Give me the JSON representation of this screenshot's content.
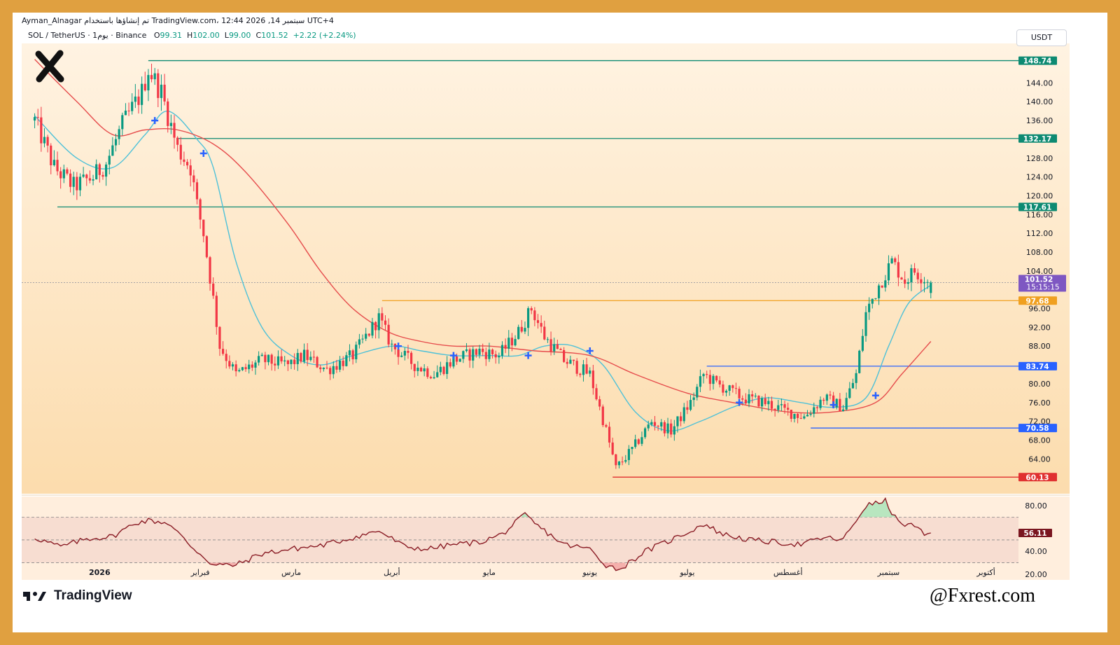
{
  "header": {
    "author": "Ayman_Alnagar",
    "published_note": "تم إنشاؤها باستخدام TradingView.com، 12:44 2026 ,14 سبتمبر UTC+4",
    "symbol": "SOL / TetherUS · 1يوم · Binance",
    "open_label": "O",
    "open": "99.31",
    "high_label": "H",
    "high": "102.00",
    "low_label": "L",
    "low": "99.00",
    "close_label": "C",
    "close": "101.52",
    "change": "+2.22 (+2.24%)",
    "currency": "USDT"
  },
  "footer": {
    "tradingview_logo": "TradingView",
    "handle": "@Fxrest.com"
  },
  "icons": {
    "brand": "x-brand-icon",
    "tradingview": "tradingview-logo-icon"
  },
  "colors": {
    "frame": "#e0a040",
    "background_top": "#fff3e2",
    "background_bottom": "#fcdcad",
    "bull": "#089981",
    "bear": "#f23645",
    "fast_ma": "#4ec1d8",
    "slow_ma": "#e64d4d",
    "resistance": "#0d8a72",
    "support": "#2962ff",
    "orange_level": "#f0a020",
    "low_level": "#e03030",
    "last_price": "#7e57c2",
    "rsi": "#8a1c25"
  },
  "chart_data": [
    {
      "type": "candlestick",
      "title": "SOL / TetherUS",
      "xlabel": "",
      "ylabel": "",
      "ylim": [
        56.6,
        152.4
      ],
      "y_ticks": [
        "144.00",
        "140.00",
        "136.00",
        "128.00",
        "124.00",
        "120.00",
        "116.00",
        "112.00",
        "108.00",
        "104.00",
        "96.00",
        "92.00",
        "88.00",
        "80.00",
        "76.00",
        "72.00",
        "68.00",
        "64.00"
      ],
      "x_ticks": [
        {
          "label": "2026",
          "date": "2026-01-01"
        },
        {
          "label": "فبراير",
          "date": "2026-02-01"
        },
        {
          "label": "مارس",
          "date": "2026-03-01"
        },
        {
          "label": "أبريل",
          "date": "2026-04-01"
        },
        {
          "label": "مايو",
          "date": "2026-05-01"
        },
        {
          "label": "يونيو",
          "date": "2026-06-01"
        },
        {
          "label": "يوليو",
          "date": "2026-07-01"
        },
        {
          "label": "أغسطس",
          "date": "2026-08-01"
        },
        {
          "label": "سبتمبر",
          "date": "2026-09-01"
        },
        {
          "label": "أكتوبر",
          "date": "2026-10-01"
        }
      ],
      "price_path": [
        [
          "2025-12-12",
          136
        ],
        [
          "2025-12-18",
          126
        ],
        [
          "2025-12-24",
          122
        ],
        [
          "2025-12-30",
          124
        ],
        [
          "2026-01-03",
          127
        ],
        [
          "2026-01-08",
          135
        ],
        [
          "2026-01-14",
          142
        ],
        [
          "2026-01-16",
          147
        ],
        [
          "2026-01-20",
          142
        ],
        [
          "2026-01-25",
          130
        ],
        [
          "2026-01-29",
          126
        ],
        [
          "2026-01-31",
          118
        ],
        [
          "2026-02-02",
          112
        ],
        [
          "2026-02-05",
          98
        ],
        [
          "2026-02-07",
          88
        ],
        [
          "2026-02-12",
          82
        ],
        [
          "2026-02-20",
          85
        ],
        [
          "2026-02-28",
          84
        ],
        [
          "2026-03-05",
          86
        ],
        [
          "2026-03-12",
          83
        ],
        [
          "2026-03-20",
          86
        ],
        [
          "2026-03-28",
          94
        ],
        [
          "2026-04-01",
          88
        ],
        [
          "2026-04-08",
          84
        ],
        [
          "2026-04-14",
          82
        ],
        [
          "2026-04-20",
          85
        ],
        [
          "2026-04-28",
          87
        ],
        [
          "2026-05-04",
          86
        ],
        [
          "2026-05-10",
          91
        ],
        [
          "2026-05-14",
          96
        ],
        [
          "2026-05-18",
          90
        ],
        [
          "2026-05-24",
          85
        ],
        [
          "2026-06-01",
          82
        ],
        [
          "2026-06-06",
          70
        ],
        [
          "2026-06-09",
          62
        ],
        [
          "2026-06-14",
          66
        ],
        [
          "2026-06-20",
          72
        ],
        [
          "2026-06-26",
          70
        ],
        [
          "2026-07-02",
          76
        ],
        [
          "2026-07-06",
          82
        ],
        [
          "2026-07-10",
          80
        ],
        [
          "2026-07-18",
          77
        ],
        [
          "2026-07-25",
          76
        ],
        [
          "2026-08-01",
          74
        ],
        [
          "2026-08-06",
          73
        ],
        [
          "2026-08-12",
          77
        ],
        [
          "2026-08-18",
          75
        ],
        [
          "2026-08-22",
          82
        ],
        [
          "2026-08-25",
          95
        ],
        [
          "2026-08-29",
          101
        ],
        [
          "2026-09-02",
          106
        ],
        [
          "2026-09-06",
          102
        ],
        [
          "2026-09-09",
          104
        ],
        [
          "2026-09-14",
          101.52
        ]
      ],
      "horizontal_levels": [
        {
          "value": 148.74,
          "label": "148.74",
          "kind": "resistance",
          "from": "2026-01-16"
        },
        {
          "value": 132.17,
          "label": "132.17",
          "kind": "resistance",
          "from": "2026-01-25"
        },
        {
          "value": 117.61,
          "label": "117.61",
          "kind": "resistance",
          "from": "2025-12-19"
        },
        {
          "value": 97.68,
          "label": "97.68",
          "kind": "orange",
          "from": "2026-03-29"
        },
        {
          "value": 83.74,
          "label": "83.74",
          "kind": "support",
          "from": "2026-07-07"
        },
        {
          "value": 70.58,
          "label": "70.58",
          "kind": "support",
          "from": "2026-08-08"
        },
        {
          "value": 60.13,
          "label": "60.13",
          "kind": "low",
          "from": "2026-06-08"
        }
      ],
      "last_price": {
        "value": 101.52,
        "label": "101.52",
        "countdown": "15:15:15"
      },
      "cross_markers": [
        [
          "2026-01-18",
          136
        ],
        [
          "2026-02-02",
          129
        ],
        [
          "2026-04-03",
          88
        ],
        [
          "2026-04-20",
          86
        ],
        [
          "2026-05-13",
          86
        ],
        [
          "2026-06-01",
          87
        ],
        [
          "2026-07-17",
          76
        ],
        [
          "2026-08-15",
          75.5
        ],
        [
          "2026-08-28",
          77.5
        ]
      ],
      "moving_averages": [
        {
          "color_key": "fast_ma",
          "points": [
            [
              "2025-12-12",
              137
            ],
            [
              "2025-12-25",
              128
            ],
            [
              "2026-01-05",
              126
            ],
            [
              "2026-01-15",
              133
            ],
            [
              "2026-01-22",
              138
            ],
            [
              "2026-01-31",
              132
            ],
            [
              "2026-02-05",
              126
            ],
            [
              "2026-02-12",
              106
            ],
            [
              "2026-02-20",
              92
            ],
            [
              "2026-03-01",
              86
            ],
            [
              "2026-03-10",
              84
            ],
            [
              "2026-03-20",
              86
            ],
            [
              "2026-04-01",
              88
            ],
            [
              "2026-04-10",
              87
            ],
            [
              "2026-04-20",
              86
            ],
            [
              "2026-05-01",
              86
            ],
            [
              "2026-05-10",
              86
            ],
            [
              "2026-05-18",
              88
            ],
            [
              "2026-05-27",
              88
            ],
            [
              "2026-06-05",
              84
            ],
            [
              "2026-06-15",
              74
            ],
            [
              "2026-06-25",
              70
            ],
            [
              "2026-07-05",
              72
            ],
            [
              "2026-07-15",
              75
            ],
            [
              "2026-07-25",
              77
            ],
            [
              "2026-08-05",
              76
            ],
            [
              "2026-08-15",
              75
            ],
            [
              "2026-08-25",
              77
            ],
            [
              "2026-09-01",
              88
            ],
            [
              "2026-09-07",
              97
            ],
            [
              "2026-09-14",
              101
            ]
          ]
        },
        {
          "color_key": "slow_ma",
          "points": [
            [
              "2025-12-12",
              149
            ],
            [
              "2025-12-25",
              140
            ],
            [
              "2026-01-05",
              133
            ],
            [
              "2026-01-15",
              134
            ],
            [
              "2026-01-25",
              134
            ],
            [
              "2026-02-05",
              131
            ],
            [
              "2026-02-15",
              125
            ],
            [
              "2026-02-28",
              114
            ],
            [
              "2026-03-10",
              104
            ],
            [
              "2026-03-20",
              96
            ],
            [
              "2026-03-31",
              91
            ],
            [
              "2026-04-10",
              89
            ],
            [
              "2026-04-20",
              88
            ],
            [
              "2026-05-01",
              88
            ],
            [
              "2026-05-15",
              87
            ],
            [
              "2026-06-01",
              86
            ],
            [
              "2026-06-15",
              82
            ],
            [
              "2026-07-01",
              78
            ],
            [
              "2026-07-15",
              76
            ],
            [
              "2026-08-01",
              74
            ],
            [
              "2026-08-15",
              74
            ],
            [
              "2026-08-28",
              76
            ],
            [
              "2026-09-05",
              82
            ],
            [
              "2026-09-14",
              89
            ]
          ]
        }
      ]
    },
    {
      "type": "line",
      "title": "",
      "xlabel": "",
      "ylabel": "",
      "ylim": [
        15,
        88
      ],
      "y_ticks": [
        "80.00",
        "40.00",
        "20.00"
      ],
      "bands": [
        30,
        50,
        70
      ],
      "last_value": {
        "value": 56.11,
        "label": "56.11"
      },
      "rsi_path": [
        [
          "2025-12-12",
          52
        ],
        [
          "2025-12-20",
          44
        ],
        [
          "2025-12-28",
          51
        ],
        [
          "2026-01-05",
          53
        ],
        [
          "2026-01-12",
          65
        ],
        [
          "2026-01-16",
          67
        ],
        [
          "2026-01-22",
          65
        ],
        [
          "2026-01-29",
          45
        ],
        [
          "2026-02-05",
          28
        ],
        [
          "2026-02-12",
          28
        ],
        [
          "2026-02-20",
          38
        ],
        [
          "2026-03-01",
          42
        ],
        [
          "2026-03-10",
          45
        ],
        [
          "2026-03-20",
          52
        ],
        [
          "2026-03-28",
          58
        ],
        [
          "2026-04-05",
          44
        ],
        [
          "2026-04-12",
          42
        ],
        [
          "2026-04-20",
          46
        ],
        [
          "2026-04-28",
          48
        ],
        [
          "2026-05-05",
          55
        ],
        [
          "2026-05-12",
          72
        ],
        [
          "2026-05-16",
          62
        ],
        [
          "2026-05-24",
          46
        ],
        [
          "2026-06-01",
          42
        ],
        [
          "2026-06-06",
          28
        ],
        [
          "2026-06-10",
          24
        ],
        [
          "2026-06-18",
          40
        ],
        [
          "2026-06-26",
          50
        ],
        [
          "2026-07-02",
          58
        ],
        [
          "2026-07-06",
          64
        ],
        [
          "2026-07-12",
          55
        ],
        [
          "2026-07-20",
          50
        ],
        [
          "2026-07-28",
          48
        ],
        [
          "2026-08-05",
          46
        ],
        [
          "2026-08-12",
          52
        ],
        [
          "2026-08-18",
          50
        ],
        [
          "2026-08-25",
          80
        ],
        [
          "2026-08-31",
          84
        ],
        [
          "2026-09-04",
          65
        ],
        [
          "2026-09-09",
          62
        ],
        [
          "2026-09-12",
          54
        ],
        [
          "2026-09-14",
          56.11
        ]
      ]
    }
  ]
}
